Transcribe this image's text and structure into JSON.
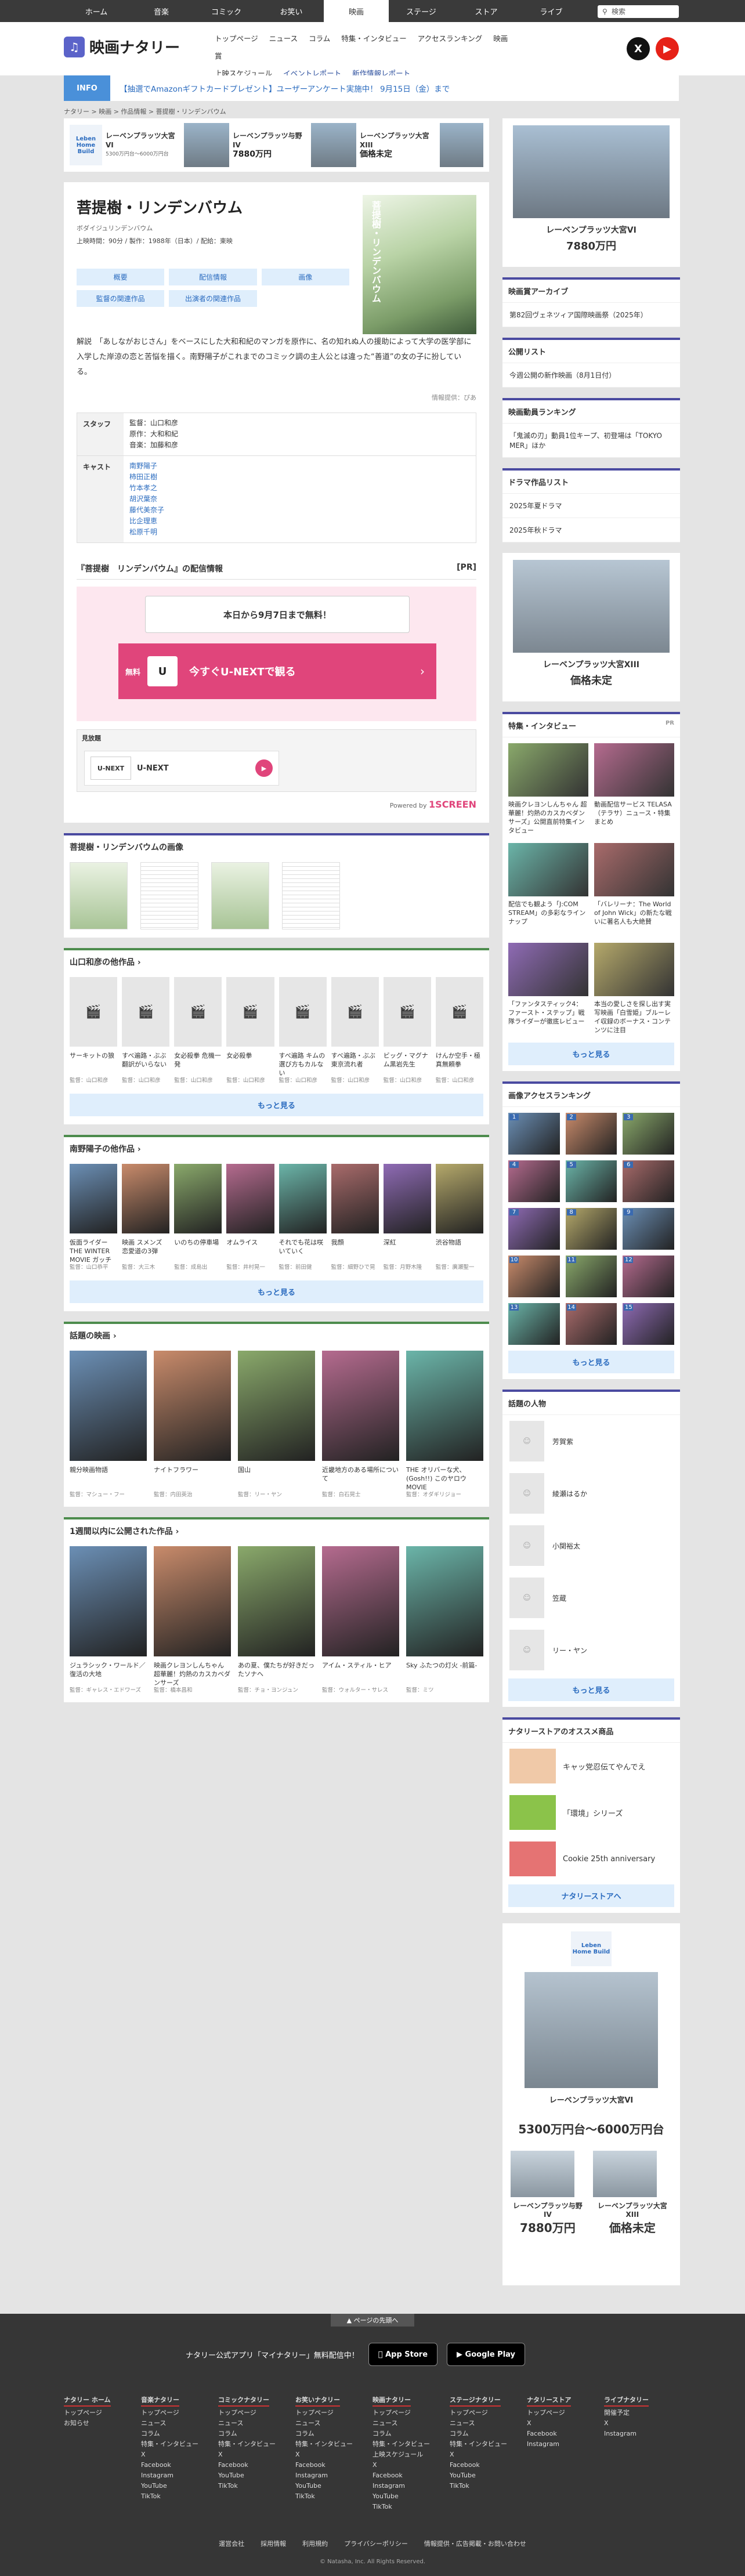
{
  "topnav": {
    "items": [
      "ホーム",
      "音楽",
      "コミック",
      "お笑い",
      "映画",
      "ステージ",
      "ストア",
      "ライブ"
    ],
    "active_index": 4,
    "search_placeholder": "検索"
  },
  "header": {
    "logo_text": "映画ナタリー",
    "subnav_row1": [
      "トップページ",
      "ニュース",
      "コラム",
      "特集・インタビュー",
      "アクセスランキング",
      "映画賞"
    ],
    "subnav_row2": [
      "上映スケジュール",
      "イベントレポート",
      "新作情報レポート"
    ]
  },
  "info": {
    "label": "INFO",
    "text": "【抽選でAmazonギフトカードプレゼント】ユーザーアンケート実施中！ 9月15日（金）まで"
  },
  "breadcrumb": "ナタリー > 映画 > 作品情報 > 菩提樹・リンデンバウム",
  "ad_top": {
    "brand": "Leben Home Build",
    "units": [
      {
        "name": "レーベンプラッツ大宮VI",
        "price": "5300万円台〜6000万円台"
      },
      {
        "name": "レーベンプラッツ与野IV",
        "price": "7880万円"
      },
      {
        "name": "レーベンプラッツ大宮XIII",
        "price": "価格未定"
      }
    ]
  },
  "movie": {
    "title": "菩提樹・リンデンバウム",
    "kana": "ボダイジュリンデンバウム",
    "meta": "上映時間：90分 / 製作：1988年（日本）/ 配給：東映",
    "tabs": [
      "概要",
      "配信情報",
      "画像",
      "監督の関連作品",
      "出演者の関連作品"
    ],
    "synopsis": "解説　「あしながおじさん」をベースにした大和和紀のマンガを原作に、名の知れぬ人の援助によって大学の医学部に入学した岸涼の恋と苦悩を描く。南野陽子がこれまでのコミック調の主人公とは違った“善道”の女の子に扮している。",
    "credit": "情報提供：ぴあ",
    "staff_label": "スタッフ",
    "staff": [
      "監督：山口和彦",
      "原作：大和和紀",
      "音楽：加藤和彦"
    ],
    "cast_label": "キャスト",
    "cast": [
      "南野陽子",
      "柿田正樹",
      "竹本孝之",
      "胡沢葉奈",
      "藤代美奈子",
      "比企理恵",
      "松原千明"
    ]
  },
  "distribution": {
    "title": "『菩提樹　リンデンバウム』の配信情報",
    "pr": "[PR]",
    "free_text": "本日から9月7日まで無料！",
    "free_badge": "無料",
    "service_icon": "U",
    "button_label": "今すぐU-NEXTで観る",
    "mihodai_label": "見放題",
    "service_logo": "U-NEXT",
    "service_name": "U-NEXT",
    "powered": "Powered by",
    "powered_brand": "1SCREEN"
  },
  "images_section": {
    "title": "菩提樹・リンデンバウムの画像"
  },
  "director_works": {
    "title": "山口和彦の他作品",
    "items": [
      {
        "title": "サーキットの狼",
        "dir": "監督：山口和彦"
      },
      {
        "title": "すべ遍路・ぶぶ翻訳がいらない",
        "dir": "監督：山口和彦"
      },
      {
        "title": "女必殺拳 危機一発",
        "dir": "監督：山口和彦"
      },
      {
        "title": "女必殺拳",
        "dir": "監督：山口和彦"
      },
      {
        "title": "すべ遍路 キムの選び方もカルない",
        "dir": "監督：山口和彦"
      },
      {
        "title": "すべ遍路・ぶぶ 東京流れ者",
        "dir": "監督：山口和彦"
      },
      {
        "title": "ビッグ・マグナム黒岩先生",
        "dir": "監督：山口和彦"
      },
      {
        "title": "けんか空手・極真無頼拳",
        "dir": "監督：山口和彦"
      }
    ],
    "more": "もっと見る"
  },
  "actor_works": {
    "title": "南野陽子の他作品",
    "items": [
      {
        "title": "仮面ライダー THE WINTER MOVIE ガッチャード",
        "dir": "監督：山口恭平"
      },
      {
        "title": "映画 スメンズ 恋愛道の3弾",
        "dir": "監督：大三木"
      },
      {
        "title": "いのちの停車場",
        "dir": "監督：成島出"
      },
      {
        "title": "オムライス",
        "dir": "監督：井村晃一"
      },
      {
        "title": "それでも花は咲いていく",
        "dir": "監督：前田健"
      },
      {
        "title": "我顔",
        "dir": "監督：細野ひで晃"
      },
      {
        "title": "深紅",
        "dir": "監督：月野木隆"
      },
      {
        "title": "渋谷物語",
        "dir": "監督：廣瀬聖一"
      }
    ],
    "more": "もっと見る"
  },
  "hot_movies": {
    "title": "話題の映画",
    "items": [
      {
        "title": "親分映画物語",
        "dir": "監督：マシュー・フー"
      },
      {
        "title": "ナイトフラワー",
        "dir": "監督：内田英治"
      },
      {
        "title": "国山",
        "dir": "監督：リー・ヤン"
      },
      {
        "title": "近畿地方のある場所について",
        "dir": "監督：白石晃士"
      },
      {
        "title": "THE オリバーな犬、(Gosh!!) このヤロウ MOVIE",
        "dir": "監督：オダギリジョー"
      }
    ]
  },
  "week_movies": {
    "title": "1週間以内に公開された作品",
    "items": [
      {
        "title": "ジュラシック・ワールド／復活の大地",
        "dir": "監督：ギャレス・エドワーズ"
      },
      {
        "title": "映画クレヨンしんちゃん 超華麗！灼熱のカスカベダンサーズ",
        "dir": "監督：橋本昌和"
      },
      {
        "title": "あの夏、僕たちが好きだったソナへ",
        "dir": "監督：チョ・ヨンジュン"
      },
      {
        "title": "アイム・スティル・ヒア",
        "dir": "監督：ウォルター・サレス"
      },
      {
        "title": "Sky ふたつの灯火 -前篇-",
        "dir": "監督：ミツ"
      }
    ]
  },
  "side_ad1": {
    "name": "レーベンプラッツ大宮VI",
    "price": "7880万円"
  },
  "award_archive": {
    "title": "映画賞アーカイブ",
    "items": [
      "第82回ヴェネツィア国際映画祭（2025年）"
    ]
  },
  "release_list": {
    "title": "公開リスト",
    "items": [
      "今週公開の新作映画（8月1日付）"
    ]
  },
  "box_office": {
    "title": "映画動員ランキング",
    "items": [
      "「鬼滅の刃」動員1位キープ、初登場は「TOKYO MER」ほか"
    ]
  },
  "drama_list": {
    "title": "ドラマ作品リスト",
    "items": [
      "2025年夏ドラマ",
      "2025年秋ドラマ"
    ]
  },
  "side_ad2": {
    "name": "レーベンプラッツ大宮XIII",
    "price": "価格未定"
  },
  "features": {
    "title": "特集・インタビュー",
    "pr": "PR",
    "items": [
      {
        "text": "映画クレヨンしんちゃん 超華麗！灼熱のカスカベダンサーズ」公開直前特集インタビュー"
      },
      {
        "text": "動画配信サービス TELASA（テラサ）ニュース・特集まとめ"
      },
      {
        "text": "配信でも観よう「J:COM STREAM」の多彩なラインナップ"
      },
      {
        "text": "「バレリーナ：The World of John Wick」の新たな戦いに著名人も大絶賛"
      },
      {
        "text": "「ファンタスティック4：ファースト・ステップ」戦隊ライダーが徹底レビュー"
      },
      {
        "text": "本当の愛しさを探し出す実写映画「白雪姫」ブルーレイ収録のボーナス・コンテンツに注目"
      }
    ],
    "more": "もっと見る"
  },
  "image_ranking": {
    "title": "画像アクセスランキング",
    "count": 15,
    "more": "もっと見る"
  },
  "hot_people": {
    "title": "話題の人物",
    "items": [
      "芳賀紫",
      "綾瀬はるか",
      "小関裕太",
      "笠蔵",
      "リー・ヤン"
    ],
    "more": "もっと見る"
  },
  "store": {
    "title": "ナタリーストアのオススメ商品",
    "items": [
      "キャッ党忍伝てやんでえ",
      "「環境」シリーズ",
      "Cookie 25th anniversary"
    ],
    "more": "ナタリーストアへ"
  },
  "side_ad3": {
    "brand": "Leben Home Build",
    "name": "レーベンプラッツ大宮VI",
    "price": "5300万円台〜6000万円台",
    "name2": "レーベンプラッツ与野IV",
    "price2": "7880万円",
    "name3": "レーベンプラッツ大宮XIII",
    "price3": "価格未定"
  },
  "footer": {
    "page_top": "ページの先頭へ",
    "app_text": "ナタリー公式アプリ「マイナタリー」無料配信中！",
    "appstore": "App Store",
    "googleplay": "Google Play",
    "columns": [
      {
        "head": "ナタリー ホーム",
        "links": [
          "トップページ",
          "お知らせ"
        ]
      },
      {
        "head": "音楽ナタリー",
        "links": [
          "トップページ",
          "ニュース",
          "コラム",
          "特集・インタビュー",
          "X",
          "Facebook",
          "Instagram",
          "YouTube",
          "TikTok"
        ]
      },
      {
        "head": "コミックナタリー",
        "links": [
          "トップページ",
          "ニュース",
          "コラム",
          "特集・インタビュー",
          "X",
          "Facebook",
          "YouTube",
          "TikTok"
        ]
      },
      {
        "head": "お笑いナタリー",
        "links": [
          "トップページ",
          "ニュース",
          "コラム",
          "特集・インタビュー",
          "X",
          "Facebook",
          "Instagram",
          "YouTube",
          "TikTok"
        ]
      },
      {
        "head": "映画ナタリー",
        "links": [
          "トップページ",
          "ニュース",
          "コラム",
          "特集・インタビュー",
          "上映スケジュール",
          "X",
          "Facebook",
          "Instagram",
          "YouTube",
          "TikTok"
        ]
      },
      {
        "head": "ステージナタリー",
        "links": [
          "トップページ",
          "ニュース",
          "コラム",
          "特集・インタビュー",
          "X",
          "Facebook",
          "YouTube",
          "TikTok"
        ]
      },
      {
        "head": "ナタリーストア",
        "links": [
          "トップページ",
          "X",
          "Facebook",
          "Instagram"
        ]
      },
      {
        "head": "ライブナタリー",
        "links": [
          "開催予定",
          "X",
          "Instagram"
        ]
      }
    ],
    "bottom_links": [
      "運営会社",
      "採用情報",
      "利用規約",
      "プライバシーポリシー",
      "情報提供・広告掲載・お問い合わせ"
    ],
    "copyright": "© Natasha, Inc. All Rights Reserved."
  },
  "colors": {
    "accent": "#4a4aa0",
    "link": "#2a6bbf",
    "unext": "#e0457b",
    "header_dark": "#3a3a3a"
  }
}
